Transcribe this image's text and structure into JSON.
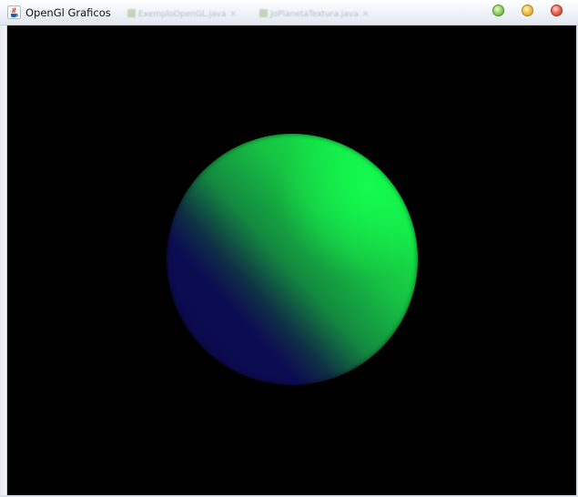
{
  "window": {
    "title": "OpenGl Graficos",
    "app_icon": "java-cup-icon",
    "controls": [
      "maximize-button-green",
      "minimize-button-yellow",
      "close-button-red"
    ],
    "colors": {
      "green": "#7fc94f",
      "yellow": "#eeb73a",
      "red": "#e0513a"
    }
  },
  "ghost_tabs": [
    {
      "label": "ExemploOpenGL.java"
    },
    {
      "label": "JoPlanetaTextura.java"
    }
  ],
  "canvas": {
    "background": "#000000",
    "object": "shaded-sphere",
    "colors": {
      "lit": "#12f04a",
      "shadow": "#0c0c52"
    }
  }
}
